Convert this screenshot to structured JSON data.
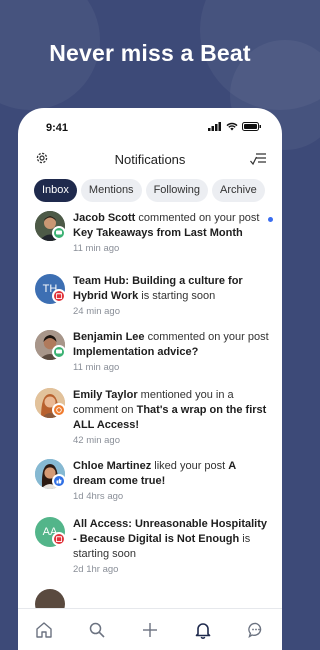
{
  "headline": "Never miss a Beat",
  "status_bar": {
    "time": "9:41"
  },
  "header": {
    "title": "Notifications"
  },
  "tabs": [
    {
      "label": "Inbox",
      "active": true
    },
    {
      "label": "Mentions",
      "active": false
    },
    {
      "label": "Following",
      "active": false
    },
    {
      "label": "Archive",
      "active": false
    }
  ],
  "notifications": [
    {
      "actor": "Jacob Scott",
      "action": " commented on your post ",
      "subject": "Key Takeaways from Last Month",
      "time": "11 min ago",
      "avatar": "photo",
      "badge": "comment",
      "unread": true
    },
    {
      "actor": "",
      "action": " is starting soon",
      "subject": "Team Hub: Building a culture for Hybrid Work",
      "time": "24 min ago",
      "avatar": "TH",
      "badge": "event",
      "unread": false
    },
    {
      "actor": "Benjamin Lee",
      "action": " commented on your post ",
      "subject": "Implementation advice?",
      "time": "11 min ago",
      "avatar": "photo",
      "badge": "comment",
      "unread": false
    },
    {
      "actor": "Emily Taylor",
      "action": " mentioned you in a comment on ",
      "subject": "That's a wrap on the first ALL Access!",
      "time": "42 min ago",
      "avatar": "photo",
      "badge": "mention",
      "unread": false
    },
    {
      "actor": "Chloe Martinez",
      "action": " liked your post ",
      "subject": "A dream come true!",
      "time": "1d 4hrs ago",
      "avatar": "photo",
      "badge": "like",
      "unread": false
    },
    {
      "actor": "",
      "action": " is starting soon",
      "subject": "All Access: Unreasonable Hospitality - Because Digital is Not Enough",
      "time": "2d 1hr ago",
      "avatar": "AA",
      "badge": "event",
      "unread": false
    }
  ],
  "colors": {
    "background": "#3d4a78",
    "active_tab": "#1f2a4d",
    "unread_dot": "#3a6df0",
    "badge_comment": "#3bb273",
    "badge_event": "#e0323a",
    "badge_mention": "#f07b2d",
    "badge_like": "#2f6fe4",
    "avatar_th": "#3d6fb3",
    "avatar_aa": "#53b58a"
  },
  "bottom_nav": [
    "home-icon",
    "search-icon",
    "add-icon",
    "notifications-icon",
    "chat-icon"
  ]
}
